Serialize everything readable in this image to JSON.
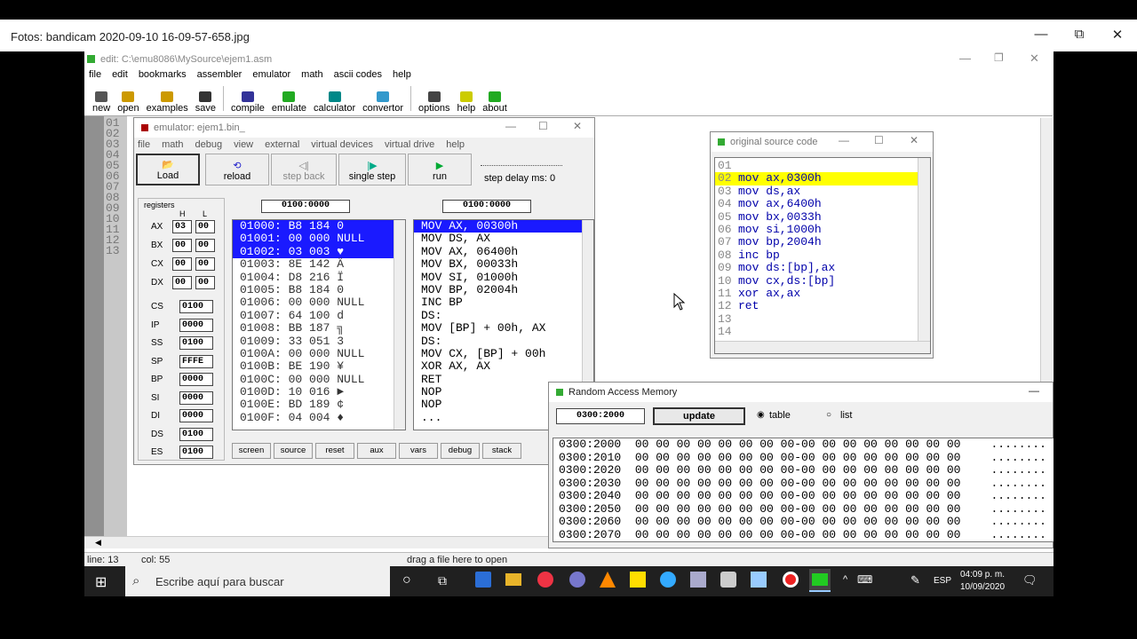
{
  "photos": {
    "title": "Fotos: bandicam 2020-09-10 16-09-57-658.jpg",
    "min": "—",
    "restore": "⧉",
    "close": "✕"
  },
  "editor": {
    "title": "edit: C:\\emu8086\\MySource\\ejem1.asm",
    "menu": [
      "file",
      "edit",
      "bookmarks",
      "assembler",
      "emulator",
      "math",
      "ascii codes",
      "help"
    ],
    "toolbar": [
      "new",
      "open",
      "examples",
      "save",
      "compile",
      "emulate",
      "calculator",
      "convertor",
      "options",
      "help",
      "about"
    ],
    "line_numbers": [
      "01",
      "02",
      "03",
      "04",
      "05",
      "06",
      "07",
      "08",
      "09",
      "10",
      "11",
      "12",
      "13"
    ],
    "status": {
      "line": "line: 13",
      "col": "col: 55",
      "drag": "drag a file here to open"
    }
  },
  "emulator": {
    "title": "emulator: ejem1.bin_",
    "menu": [
      "file",
      "math",
      "debug",
      "view",
      "external",
      "virtual devices",
      "virtual drive",
      "help"
    ],
    "buttons": [
      "Load",
      "reload",
      "step back",
      "single step",
      "run"
    ],
    "step_delay": "step delay ms: 0",
    "registers_label": "registers",
    "h": "H",
    "l": "L",
    "regs8": [
      {
        "name": "AX",
        "h": "03",
        "l": "00"
      },
      {
        "name": "BX",
        "h": "00",
        "l": "00"
      },
      {
        "name": "CX",
        "h": "00",
        "l": "00"
      },
      {
        "name": "DX",
        "h": "00",
        "l": "00"
      }
    ],
    "regs16": [
      {
        "name": "CS",
        "v": "0100"
      },
      {
        "name": "IP",
        "v": "0000"
      },
      {
        "name": "SS",
        "v": "0100"
      },
      {
        "name": "SP",
        "v": "FFFE"
      },
      {
        "name": "BP",
        "v": "0000"
      },
      {
        "name": "SI",
        "v": "0000"
      },
      {
        "name": "DI",
        "v": "0000"
      },
      {
        "name": "DS",
        "v": "0100"
      },
      {
        "name": "ES",
        "v": "0100"
      }
    ],
    "addr1": "0100:0000",
    "addr2": "0100:0000",
    "memory_rows": [
      "01000: B8 184 0",
      "01001: 00 000 NULL",
      "01002: 03 003 ♥",
      "01003: 8E 142 Ä",
      "01004: D8 216 Ï",
      "01005: B8 184 0",
      "01006: 00 000 NULL",
      "01007: 64 100 d",
      "01008: BB 187 ╗",
      "01009: 33 051 3",
      "0100A: 00 000 NULL",
      "0100B: BE 190 ¥",
      "0100C: 00 000 NULL",
      "0100D: 10 016 ►",
      "0100E: BD 189 ¢",
      "0100F: 04 004 ♦"
    ],
    "disasm_rows": [
      "MOV AX, 00300h",
      "MOV DS, AX",
      "MOV AX, 06400h",
      "MOV BX, 00033h",
      "MOV SI, 01000h",
      "MOV BP, 02004h",
      "INC BP",
      "DS:",
      "MOV [BP] + 00h, AX",
      "DS:",
      "MOV CX, [BP] + 00h",
      "XOR AX, AX",
      "RET",
      "NOP",
      "NOP",
      "..."
    ],
    "bottom_buttons": [
      "screen",
      "source",
      "reset",
      "aux",
      "vars",
      "debug",
      "stack"
    ]
  },
  "source": {
    "title": "original source code",
    "lines": [
      {
        "n": "01",
        "c": ""
      },
      {
        "n": "02",
        "c": "mov ax,0300h"
      },
      {
        "n": "03",
        "c": "mov ds,ax"
      },
      {
        "n": "04",
        "c": "mov ax,6400h"
      },
      {
        "n": "05",
        "c": "mov bx,0033h"
      },
      {
        "n": "06",
        "c": "mov si,1000h"
      },
      {
        "n": "07",
        "c": "mov bp,2004h"
      },
      {
        "n": "08",
        "c": "inc bp"
      },
      {
        "n": "09",
        "c": "mov ds:[bp],ax"
      },
      {
        "n": "10",
        "c": "mov cx,ds:[bp]"
      },
      {
        "n": "11",
        "c": "xor ax,ax"
      },
      {
        "n": "12",
        "c": "ret"
      },
      {
        "n": "13",
        "c": ""
      },
      {
        "n": "14",
        "c": ""
      }
    ]
  },
  "ram": {
    "title": "Random Access Memory",
    "address": "0300:2000",
    "update": "update",
    "table": "table",
    "list": "list",
    "rows": [
      "0300:2000  00 00 00 00 00 00 00 00-00 00 00 00 00 00 00 00",
      "0300:2010  00 00 00 00 00 00 00 00-00 00 00 00 00 00 00 00",
      "0300:2020  00 00 00 00 00 00 00 00-00 00 00 00 00 00 00 00",
      "0300:2030  00 00 00 00 00 00 00 00-00 00 00 00 00 00 00 00",
      "0300:2040  00 00 00 00 00 00 00 00-00 00 00 00 00 00 00 00",
      "0300:2050  00 00 00 00 00 00 00 00-00 00 00 00 00 00 00 00",
      "0300:2060  00 00 00 00 00 00 00 00-00 00 00 00 00 00 00 00",
      "0300:2070  00 00 00 00 00 00 00 00-00 00 00 00 00 00 00 00"
    ],
    "dots": "........"
  },
  "taskbar": {
    "search": "Escribe aquí para buscar",
    "lang": "ESP",
    "time": "04:09 p. m.",
    "date": "10/09/2020"
  },
  "colors": {
    "selection": "#1a1aff",
    "highlight": "#ffff00",
    "red_ink": "#e8431a",
    "blue_ink": "#2a1aa8",
    "green_ink": "#1a8a5a"
  }
}
